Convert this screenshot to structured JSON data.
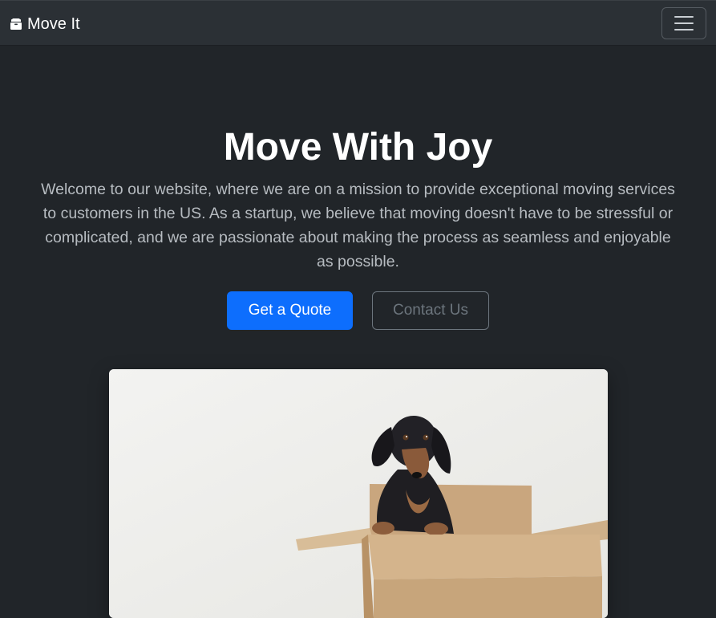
{
  "navbar": {
    "brand_text": "Move It",
    "brand_icon": "box-icon",
    "toggler_icon": "hamburger-menu-icon"
  },
  "hero": {
    "title": "Move With Joy",
    "lead": "Welcome to our website, where we are on a mission to provide exceptional moving services to customers in the US. As a startup, we believe that moving doesn't have to be stressful or complicated, and we are passionate about making the process as seamless and enjoyable as possible.",
    "primary_button": "Get a Quote",
    "secondary_button": "Contact Us"
  },
  "colors": {
    "background": "#212529",
    "navbar": "#2b3035",
    "primary": "#0d6efd",
    "secondary": "#6c757d"
  }
}
